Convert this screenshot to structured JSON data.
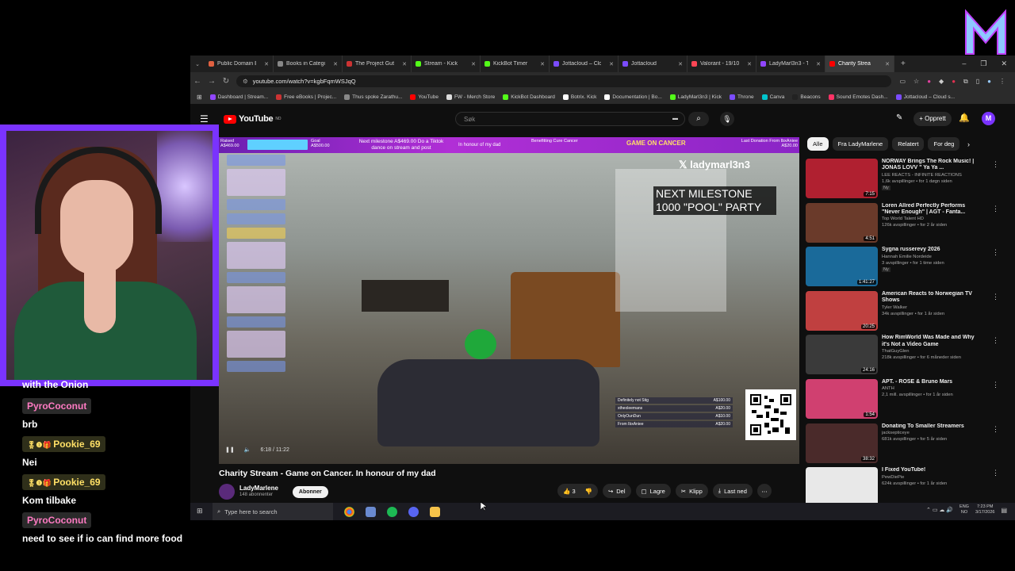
{
  "browser": {
    "tabs": [
      {
        "title": "Public Domain Bo",
        "color": "#e06040"
      },
      {
        "title": "Books in Catego",
        "color": "#888888"
      },
      {
        "title": "The Project Guten",
        "color": "#cc3333"
      },
      {
        "title": "Stream - Kick",
        "color": "#53fc18"
      },
      {
        "title": "KickBot Timer",
        "color": "#53fc18"
      },
      {
        "title": "Jottacloud – Clou",
        "color": "#7b4cff"
      },
      {
        "title": "Jottacloud",
        "color": "#7b4cff"
      },
      {
        "title": "Valorant - 19/10...",
        "color": "#ff4655"
      },
      {
        "title": "LadyMarl3n3 - Tw",
        "color": "#9146ff"
      },
      {
        "title": "Charity Strea",
        "color": "#ff0000"
      }
    ],
    "url": "youtube.com/watch?v=kgbFqmWSJqQ",
    "bookmarks": [
      {
        "label": "Dashboard | Stream...",
        "color": "#9146ff"
      },
      {
        "label": "Free eBooks | Projec...",
        "color": "#cc3333"
      },
      {
        "label": "Thus spoke Zarathu...",
        "color": "#888888"
      },
      {
        "label": "YouTube",
        "color": "#ff0000"
      },
      {
        "label": "FW - Merch Store",
        "color": "#dddddd"
      },
      {
        "label": "KickBot Dashboard",
        "color": "#53fc18"
      },
      {
        "label": "Botrix. Kick",
        "color": "#ffffff"
      },
      {
        "label": "Documentation | Bo...",
        "color": "#ffffff"
      },
      {
        "label": "LadyMarl3n3 | Kick",
        "color": "#53fc18"
      },
      {
        "label": "Throne",
        "color": "#7b4cff"
      },
      {
        "label": "Canva",
        "color": "#00c4cc"
      },
      {
        "label": "Beacons",
        "color": "#222222"
      },
      {
        "label": "Sound Emotes Dash...",
        "color": "#ff3366"
      },
      {
        "label": "Jottacloud – Cloud s...",
        "color": "#7b4cff"
      }
    ]
  },
  "youtube": {
    "logo": "YouTube",
    "region": "NO",
    "search_placeholder": "Søk",
    "create_label": "Opprett",
    "video_title": "Charity Stream - Game on Cancer. In honour of my dad",
    "channel_name": "LadyMarlene",
    "channel_subs": "148 abonnenter",
    "subscribe_label": "Abonner",
    "likes": "3",
    "share_label": "Del",
    "save_label": "Lagre",
    "clip_label": "Klipp",
    "download_label": "Last ned",
    "player_time": "6:18 / 11:22",
    "chips": [
      "Alle",
      "Fra LadyMarlene",
      "Relatert",
      "For deg"
    ]
  },
  "stream_overlay": {
    "banner_raised": "Raised A$469.00",
    "banner_goal": "Goal A$500.00",
    "banner_milestone": "Next milestone A$469.00 Do a Tiktok dance on stream and post",
    "banner_honour": "In honour of my dad",
    "banner_benefit": "Benefitting Cure Cancer",
    "banner_brand": "GAME ON CANCER",
    "banner_last": "Last Donation From IbxAniee A$20.00",
    "handle": "ladymarl3n3",
    "milestone_text": "NEXT MILESTONE 1000 \"POOL\" PARTY",
    "donors": [
      {
        "name": "Definitely not Stig",
        "amount": "A$100.00"
      },
      {
        "name": "xtheoleemans",
        "amount": "A$20.00"
      },
      {
        "name": "OnlyOunDun",
        "amount": "A$10.00"
      },
      {
        "name": "From IbxAniee",
        "amount": "A$20.00"
      }
    ]
  },
  "recommendations": [
    {
      "title": "NORWAY Brings The Rock Music! | JONAS LOVV \" Ya Ya ...",
      "channel": "LEE REACTS - INFINITE REACTIONS",
      "meta": "1,6k avspillinger • for 1 døgn siden",
      "badge": "Ny",
      "duration": "7:15",
      "color": "#b02030"
    },
    {
      "title": "Loren Allred Perfectly Performs \"Never Enough\" | AGT - Fanta...",
      "channel": "Top World Talent HD",
      "meta": "126k avspillinger • for 2 år siden",
      "badge": "",
      "duration": "4:51",
      "color": "#6a3a2a"
    },
    {
      "title": "Sygna russerevy 2026",
      "channel": "Hannah Emilie Nordeide",
      "meta": "3 avspillinger • for 1 time siden",
      "badge": "Ny",
      "duration": "1:41:27",
      "color": "#1a6a9a"
    },
    {
      "title": "American Reacts to Norwegian TV Shows",
      "channel": "Tyler Walker",
      "meta": "34k avspillinger • for 1 år siden",
      "badge": "",
      "duration": "20:25",
      "color": "#c04040"
    },
    {
      "title": "How RimWorld Was Made and Why it's Not a Video Game",
      "channel": "ThatGuyGlen",
      "meta": "218k avspillinger • for 6 måneder siden",
      "badge": "",
      "duration": "24:16",
      "color": "#3a3a3a"
    },
    {
      "title": "APT. - ROSÉ & Bruno Mars",
      "channel": "ANTH",
      "meta": "2,1 mill. avspillinger • for 1 år siden",
      "badge": "",
      "duration": "1:54",
      "color": "#d04070"
    },
    {
      "title": "Donating To Smaller Streamers",
      "channel": "jacksepticeye",
      "meta": "681k avspillinger • for 5 år siden",
      "badge": "",
      "duration": "38:32",
      "color": "#4a2a2a"
    },
    {
      "title": "I Fixed YouTube!",
      "channel": "PewDiePie",
      "meta": "624k avspillinger • for 1 år siden",
      "badge": "",
      "duration": "",
      "color": "#e8e8e8"
    }
  ],
  "taskbar": {
    "search_placeholder": "Type here to search",
    "lang": "ENG",
    "region": "NO",
    "time": "7:23 PM",
    "date": "3/17/2026"
  },
  "chat": [
    {
      "user": "",
      "message": "with the Onion",
      "style": "none"
    },
    {
      "user": "PyroCoconut",
      "message": "brb",
      "style": "pink"
    },
    {
      "user": "Pookie_69",
      "message": "Nei",
      "style": "gold"
    },
    {
      "user": "Pookie_69",
      "message": "Kom tilbake",
      "style": "gold"
    },
    {
      "user": "PyroCoconut",
      "message": "need to see if io can find more food",
      "style": "pink"
    }
  ]
}
